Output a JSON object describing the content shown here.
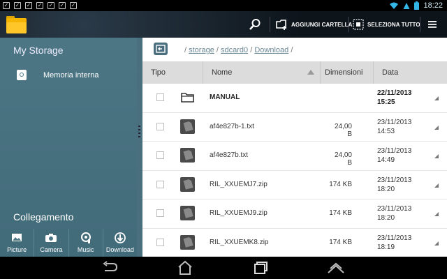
{
  "statusbar": {
    "time": "18:22",
    "notification_icons": [
      "notification-check-icon",
      "notification-check-icon",
      "notification-check-icon",
      "notification-check-icon",
      "notification-check-icon",
      "notification-check-icon",
      "notification-check-icon"
    ],
    "indicators": [
      "wifi-icon",
      "warning-icon",
      "battery-icon"
    ]
  },
  "actionbar": {
    "search_icon": "search-icon",
    "add_folder_label": "AGGIUNGI CARTELLA",
    "select_all_label": "SELEZIONA TUTTO",
    "menu_icon": "menu-icon"
  },
  "sidebar": {
    "title": "My Storage",
    "storage_item": "Memoria interna",
    "section_title": "Collegamento",
    "shortcuts": [
      {
        "label": "Picture",
        "icon": "picture-icon"
      },
      {
        "label": "Camera",
        "icon": "camera-icon"
      },
      {
        "label": "Music",
        "icon": "music-icon"
      },
      {
        "label": "Download",
        "icon": "download-icon"
      }
    ]
  },
  "breadcrumb": {
    "separator": "/",
    "parts": [
      "storage",
      "sdcard0",
      "Download"
    ]
  },
  "table": {
    "columns": {
      "type": "Tipo",
      "name": "Nome",
      "size": "Dimensioni",
      "date": "Data"
    },
    "rows": [
      {
        "icon": "folder-icon",
        "name": "MANUAL",
        "size": "",
        "date": "22/11/2013",
        "time": "15:25",
        "bold": true
      },
      {
        "icon": "file-icon",
        "name": "af4e827b-1.txt",
        "size": "24,00 B",
        "date": "23/11/2013",
        "time": "14:53",
        "bold": false
      },
      {
        "icon": "file-icon",
        "name": "af4e827b.txt",
        "size": "24,00 B",
        "date": "23/11/2013",
        "time": "14:49",
        "bold": false
      },
      {
        "icon": "file-icon",
        "name": "RIL_XXUEMJ7.zip",
        "size": "174 KB",
        "date": "23/11/2013",
        "time": "18:20",
        "bold": false
      },
      {
        "icon": "file-icon",
        "name": "RIL_XXUEMJ9.zip",
        "size": "174 KB",
        "date": "23/11/2013",
        "time": "18:20",
        "bold": false
      },
      {
        "icon": "file-icon",
        "name": "RIL_XXUEMK8.zip",
        "size": "174 KB",
        "date": "23/11/2013",
        "time": "18:19",
        "bold": false
      }
    ]
  },
  "navbar": [
    "back-icon",
    "home-icon",
    "recent-apps-icon",
    "up-icon"
  ]
}
